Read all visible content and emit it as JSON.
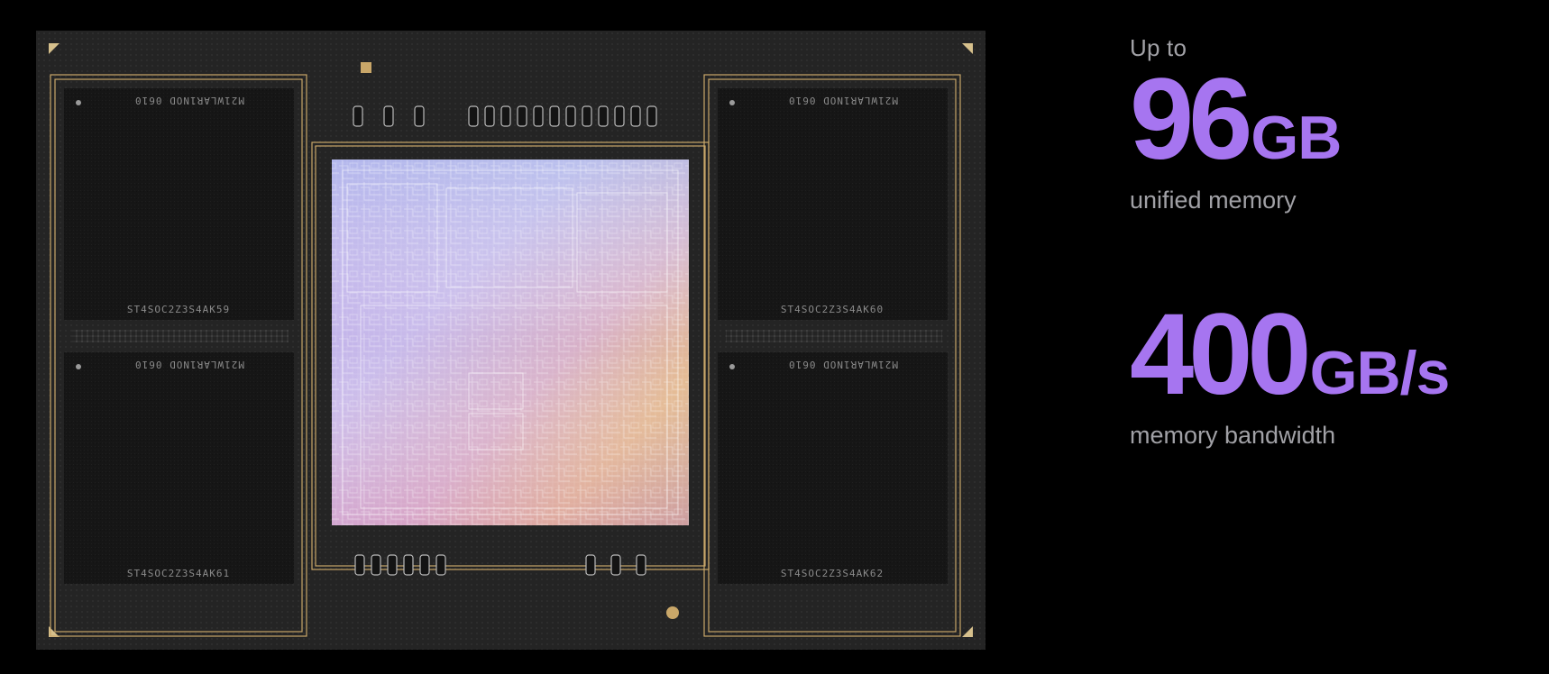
{
  "memory_stat": {
    "prefix": "Up to",
    "value": "96",
    "unit": "GB",
    "label": "unified memory"
  },
  "bandwidth_stat": {
    "value": "400",
    "unit": "GB/s",
    "label": "memory bandwidth"
  },
  "chip": {
    "memory_modules": [
      {
        "top_text": "M21WLAR1NOD 0610",
        "bottom_text": "ST4SOC2Z3S4AK59"
      },
      {
        "top_text": "M21WLAR1NOD 0610",
        "bottom_text": "ST4SOC2Z3S4AK60"
      },
      {
        "top_text": "M21WLAR1NOD 0610",
        "bottom_text": "ST4SOC2Z3S4AK61"
      },
      {
        "top_text": "M21WLAR1NOD 0610",
        "bottom_text": "ST4SOC2Z3S4AK62"
      }
    ]
  },
  "colors": {
    "accent": "#a675f0",
    "caption": "#a1a1a6",
    "background": "#000000",
    "gold": "#c9a769"
  }
}
